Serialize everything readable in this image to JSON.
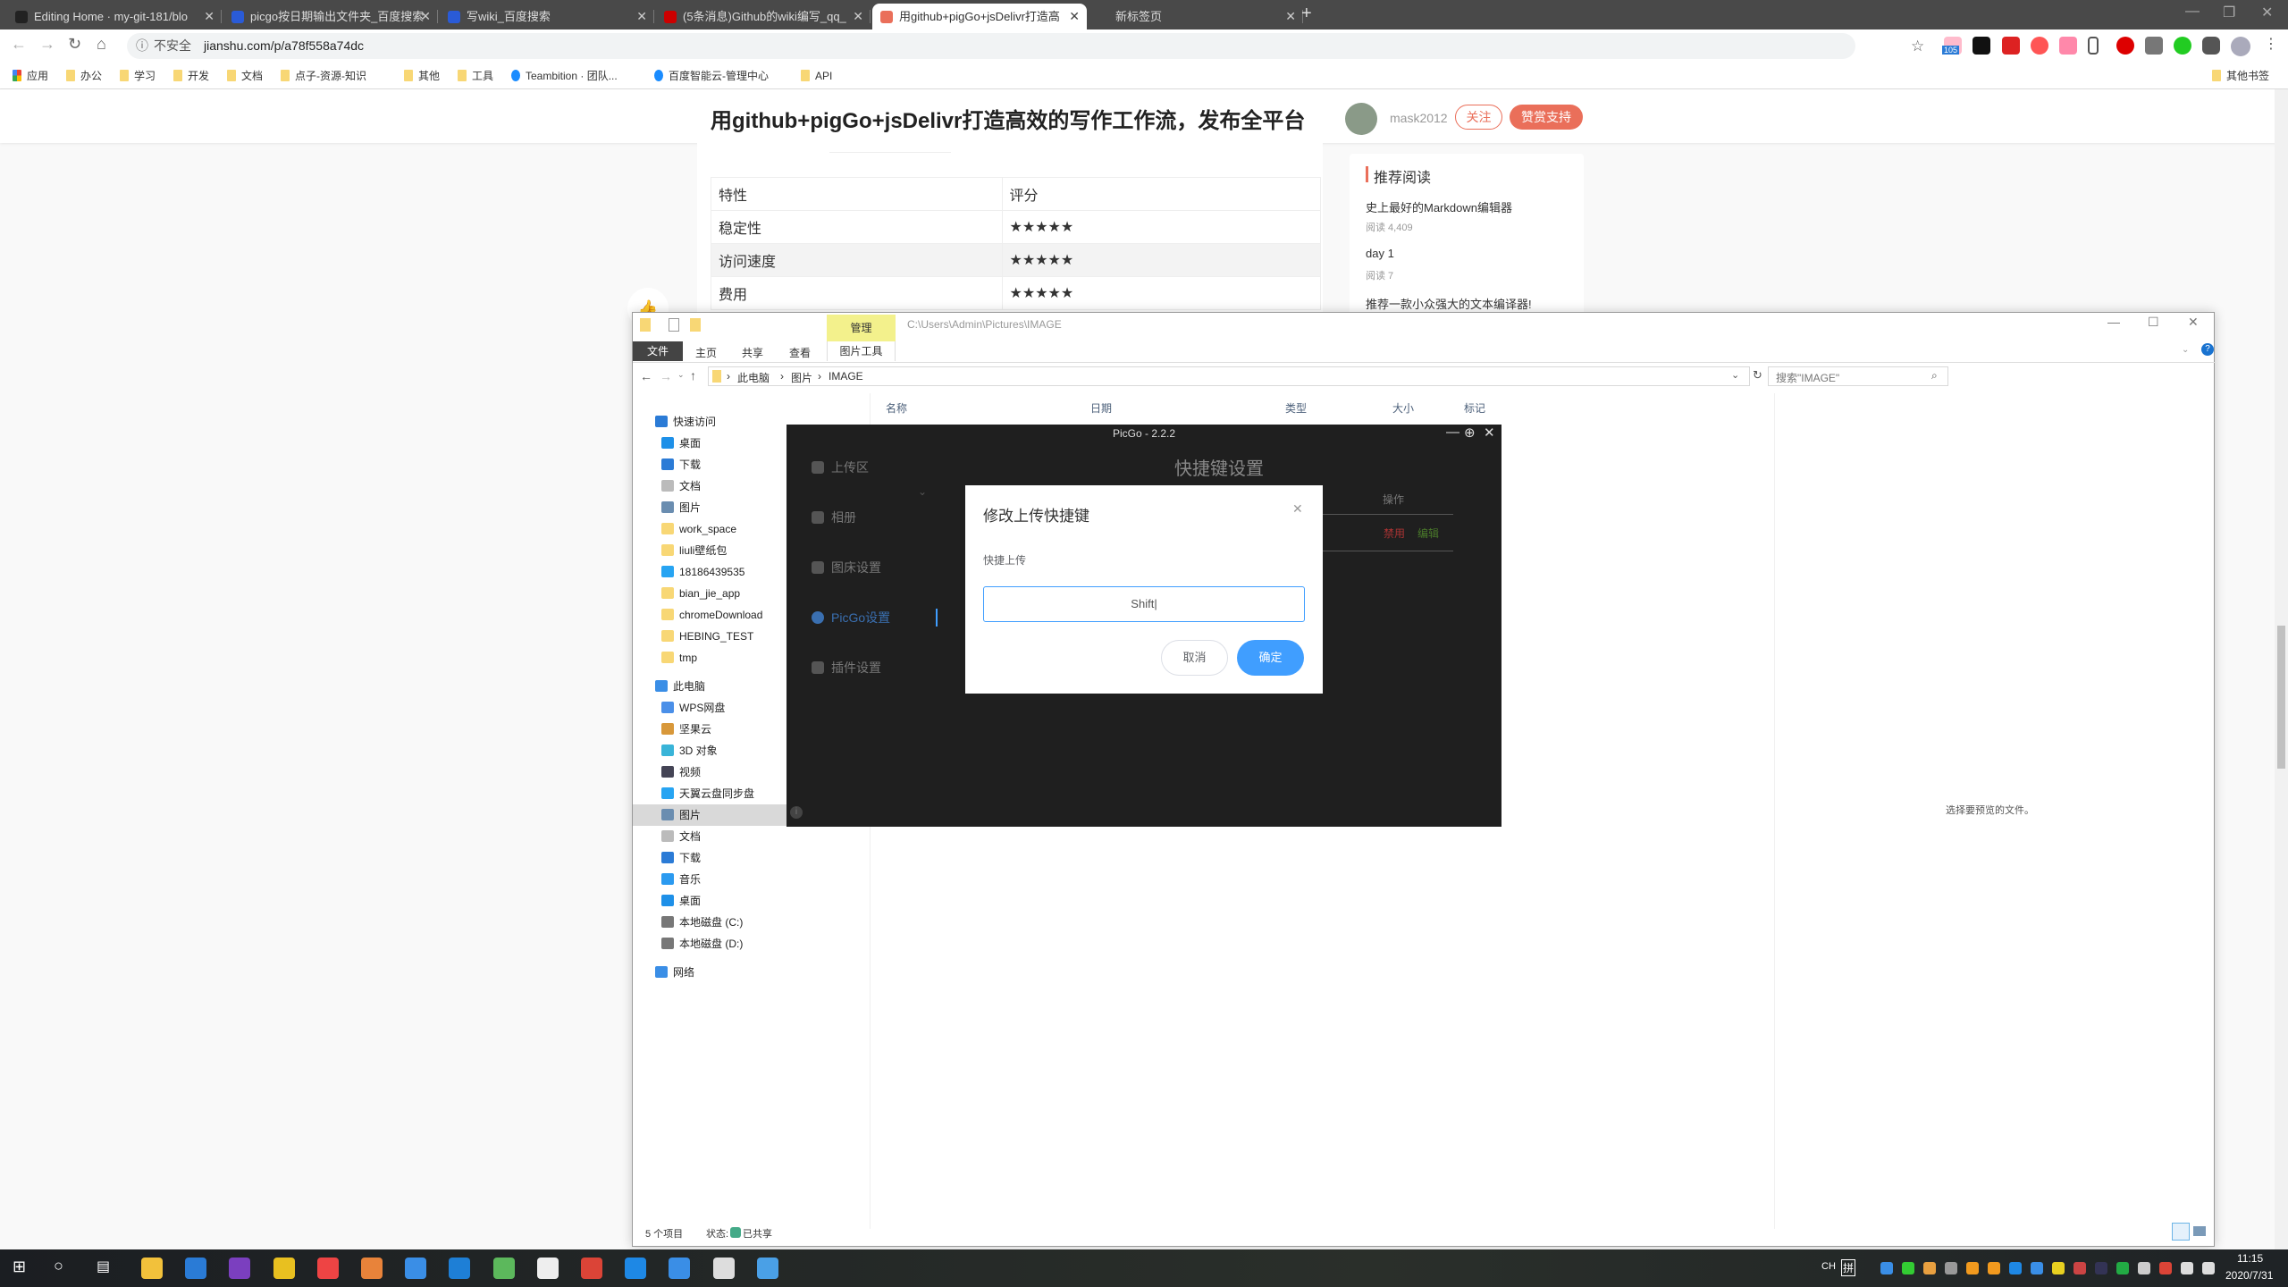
{
  "browser": {
    "tabs": [
      {
        "label": "Editing Home · my-git-181/blo",
        "color": "#222",
        "active": false
      },
      {
        "label": "picgo按日期输出文件夹_百度搜索",
        "color": "#2a5bd7",
        "active": false
      },
      {
        "label": "写wiki_百度搜索",
        "color": "#2a5bd7",
        "active": false
      },
      {
        "label": "(5条消息)Github的wiki编写_qq_",
        "color": "#c00",
        "active": false
      },
      {
        "label": "用github+pigGo+jsDelivr打造高",
        "color": "#ea6f5a",
        "active": true
      },
      {
        "label": "新标签页",
        "color": "",
        "active": false
      }
    ],
    "new_tab": "+",
    "security": "不安全",
    "url": "jianshu.com/p/a78f558a74dc",
    "ext_badge": "105",
    "bookmarks": [
      {
        "label": "应用",
        "type": "apps"
      },
      {
        "label": "办公",
        "type": "folder"
      },
      {
        "label": "学习",
        "type": "folder"
      },
      {
        "label": "开发",
        "type": "folder"
      },
      {
        "label": "文档",
        "type": "folder"
      },
      {
        "label": "点子-资源-知识",
        "type": "folder"
      },
      {
        "label": "其他",
        "type": "folder"
      },
      {
        "label": "工具",
        "type": "folder"
      },
      {
        "label": "Teambition · 团队...",
        "type": "site"
      },
      {
        "label": "百度智能云-管理中心",
        "type": "site"
      },
      {
        "label": "API",
        "type": "folder"
      }
    ],
    "other_bookmarks": "其他书签"
  },
  "page": {
    "title": "用github+pigGo+jsDelivr打造高效的写作工作流，发布全平台",
    "author": "mask2012",
    "follow": "关注",
    "reward": "赞赏支持",
    "table": {
      "headers": [
        "特性",
        "评分"
      ],
      "rows": [
        [
          "稳定性",
          "★★★★★"
        ],
        [
          "访问速度",
          "★★★★★"
        ],
        [
          "费用",
          "★★★★★"
        ]
      ]
    },
    "recommend": {
      "title": "推荐阅读",
      "items": [
        {
          "title": "史上最好的Markdown编辑器",
          "reads": "阅读 4,409"
        },
        {
          "title": "day 1",
          "reads": "阅读 7"
        },
        {
          "title": "推荐一款小众强大的文本编译器!",
          "reads": ""
        }
      ]
    }
  },
  "explorer": {
    "context_tab": "管理",
    "path_title": "C:\\Users\\Admin\\Pictures\\IMAGE",
    "ribbon_tabs": [
      "文件",
      "主页",
      "共享",
      "查看",
      "图片工具"
    ],
    "breadcrumb": [
      "此电脑",
      "图片",
      "IMAGE"
    ],
    "search_placeholder": "搜索\"IMAGE\"",
    "columns": [
      "名称",
      "日期",
      "类型",
      "大小",
      "标记"
    ],
    "nav": [
      {
        "label": "快速访问",
        "level": 0,
        "color": "#2b7bd6"
      },
      {
        "label": "桌面",
        "level": 1,
        "color": "#1e90e8"
      },
      {
        "label": "下载",
        "level": 1,
        "color": "#2b7bd6"
      },
      {
        "label": "文档",
        "level": 1,
        "color": "#bbb"
      },
      {
        "label": "图片",
        "level": 1,
        "color": "#6a8db0"
      },
      {
        "label": "work_space",
        "level": 1,
        "color": "#f8d775"
      },
      {
        "label": "liuli壁纸包",
        "level": 1,
        "color": "#f8d775"
      },
      {
        "label": "18186439535",
        "level": 1,
        "color": "#27a4f2"
      },
      {
        "label": "bian_jie_app",
        "level": 1,
        "color": "#f8d775"
      },
      {
        "label": "chromeDownload",
        "level": 1,
        "color": "#f8d775"
      },
      {
        "label": "HEBING_TEST",
        "level": 1,
        "color": "#f8d775"
      },
      {
        "label": "tmp",
        "level": 1,
        "color": "#f8d775"
      },
      {
        "label": "此电脑",
        "level": 0,
        "color": "#3a8ee6"
      },
      {
        "label": "WPS网盘",
        "level": 1,
        "color": "#4a8fe8"
      },
      {
        "label": "坚果云",
        "level": 1,
        "color": "#d8983a"
      },
      {
        "label": "3D 对象",
        "level": 1,
        "color": "#39b4d8"
      },
      {
        "label": "视频",
        "level": 1,
        "color": "#445"
      },
      {
        "label": "天翼云盘同步盘",
        "level": 1,
        "color": "#27a4f2"
      },
      {
        "label": "图片",
        "level": 1,
        "color": "#6a8db0",
        "selected": true
      },
      {
        "label": "文档",
        "level": 1,
        "color": "#bbb"
      },
      {
        "label": "下载",
        "level": 1,
        "color": "#2b7bd6"
      },
      {
        "label": "音乐",
        "level": 1,
        "color": "#2b9af0"
      },
      {
        "label": "桌面",
        "level": 1,
        "color": "#1e90e8"
      },
      {
        "label": "本地磁盘 (C:)",
        "level": 1,
        "color": "#777"
      },
      {
        "label": "本地磁盘 (D:)",
        "level": 1,
        "color": "#777"
      },
      {
        "label": "网络",
        "level": 0,
        "color": "#3a8ee6"
      }
    ],
    "preview_hint": "选择要预览的文件。",
    "status_count": "5 个项目",
    "status_state": "状态:",
    "status_shared": "已共享"
  },
  "picgo": {
    "title": "PicGo - 2.2.2",
    "menu": [
      {
        "label": "上传区"
      },
      {
        "label": "相册"
      },
      {
        "label": "图床设置"
      },
      {
        "label": "PicGo设置",
        "active": true
      },
      {
        "label": "插件设置"
      }
    ],
    "page_title": "快捷键设置",
    "col_action": "操作",
    "disable": "禁用",
    "edit": "编辑",
    "dialog": {
      "title": "修改上传快捷键",
      "label": "快捷上传",
      "value": "Shift",
      "cancel": "取消",
      "confirm": "确定"
    }
  },
  "taskbar": {
    "ime_lang": "CH",
    "ime_mode": "拼",
    "time": "11:15",
    "date": "2020/7/31"
  },
  "colors": {
    "accent": "#409eff",
    "jianshu": "#ea6f5a",
    "ribbon_context": "#f3f18c"
  }
}
